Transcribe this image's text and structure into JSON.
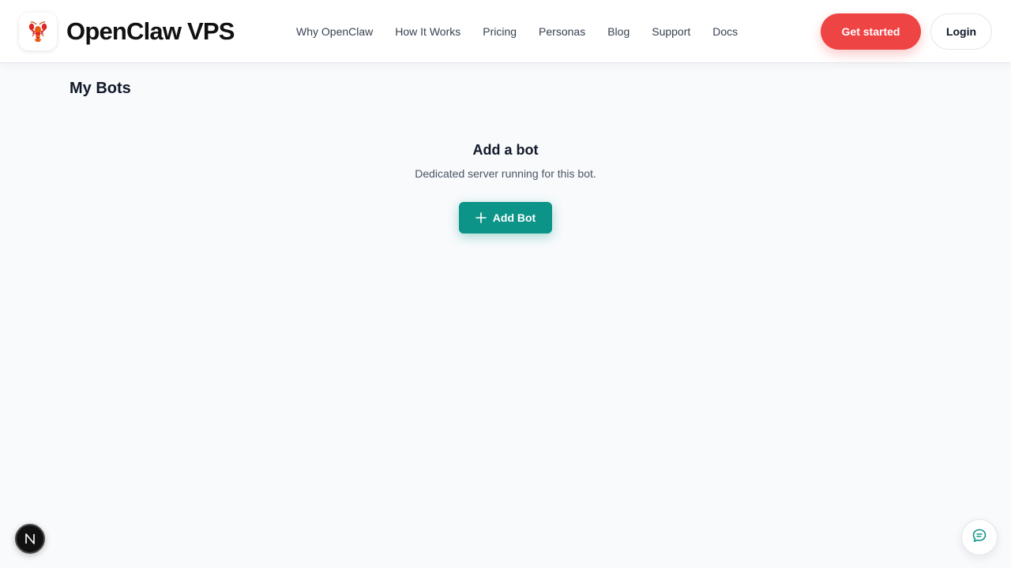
{
  "header": {
    "brand_name": "OpenClaw VPS",
    "logo_icon": "lobster-icon",
    "nav": [
      {
        "label": "Why OpenClaw"
      },
      {
        "label": "How It Works"
      },
      {
        "label": "Pricing"
      },
      {
        "label": "Personas"
      },
      {
        "label": "Blog"
      },
      {
        "label": "Support"
      },
      {
        "label": "Docs"
      }
    ],
    "get_started_label": "Get started",
    "login_label": "Login"
  },
  "main": {
    "title": "My Bots",
    "empty_state": {
      "title": "Add a bot",
      "description": "Dedicated server running for this bot.",
      "add_button_label": "Add Bot",
      "add_button_icon": "plus-icon"
    }
  },
  "floating": {
    "next_badge_icon": "n-logo-icon",
    "chat_icon": "chat-bubble-icon"
  },
  "colors": {
    "accent_red": "#ef4444",
    "accent_teal": "#0d9488",
    "background": "#f8fafc"
  }
}
